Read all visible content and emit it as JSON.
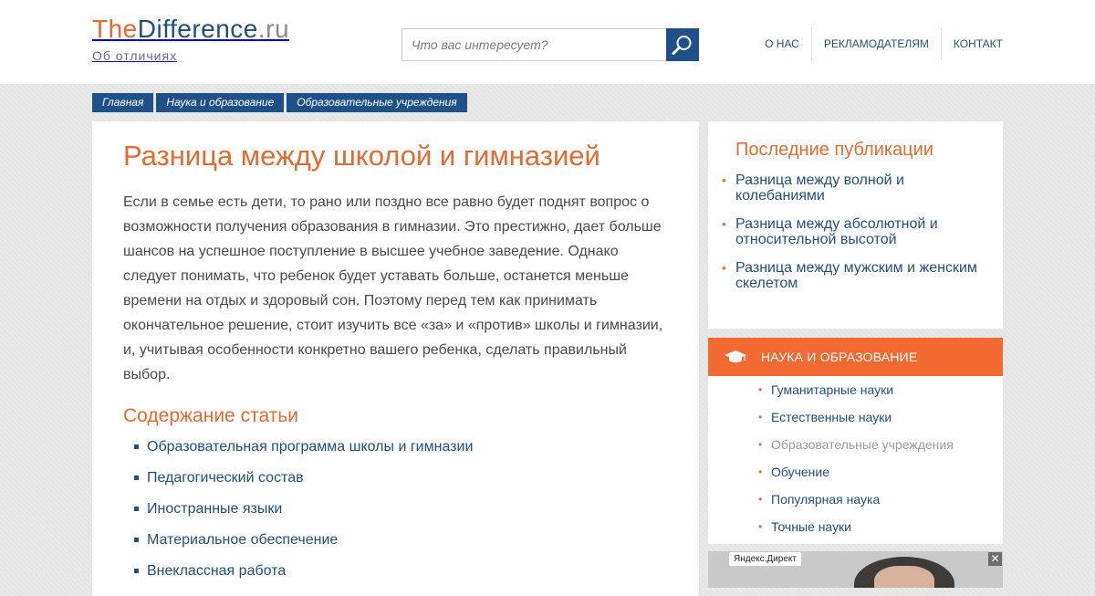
{
  "header": {
    "logo_part1": "The",
    "logo_part2": "Difference",
    "logo_part3": ".ru",
    "tagline": "Об отличиях",
    "search_placeholder": "Что вас интересует?",
    "nav": [
      "О НАС",
      "РЕКЛАМОДАТЕЛЯМ",
      "КОНТАКТ"
    ]
  },
  "breadcrumbs": [
    "Главная",
    "Наука и образование",
    "Образовательные учреждения"
  ],
  "article": {
    "title": "Разница между школой и гимназией",
    "intro": "Если в семье есть дети, то рано или поздно все равно будет поднят вопрос о возможности получения образования в гимназии. Это престижно, дает больше шансов на успешное поступление в высшее учебное заведение. Однако следует понимать, что ребенок будет уставать больше, останется меньше времени на отдых и здоровый сон. Поэтому перед тем как принимать окончательное решение, стоит изучить все «за» и «против» школы и гимназии, и, учитывая особенности конкретно вашего ребенка, сделать правильный выбор.",
    "toc_title": "Содержание статьи",
    "toc": [
      "Образовательная программа школы и гимназии",
      "Педагогический состав",
      "Иностранные языки",
      "Материальное обеспечение",
      "Внеклассная работа"
    ]
  },
  "sidebar": {
    "latest_title": "Последние публикации",
    "latest": [
      "Разница между волной и колебаниями",
      "Разница между абсолютной и относительной высотой",
      "Разница между мужским и женским скелетом"
    ],
    "category_title": "НАУКА И ОБРАЗОВАНИЕ",
    "categories": [
      "Гуманитарные науки",
      "Естественные науки",
      "Образовательные учреждения",
      "Обучение",
      "Популярная наука",
      "Точные науки"
    ],
    "active_category": "Образовательные учреждения",
    "ad_label": "Яндекс.Директ",
    "ad_close": "✕"
  },
  "colors": {
    "accent_orange": "#e8692e",
    "link_blue": "#1e4f82",
    "button_blue": "#1e5189",
    "category_header": "#f26a32"
  },
  "icons": [
    "search-icon",
    "graduation-cap-icon",
    "close-icon"
  ]
}
